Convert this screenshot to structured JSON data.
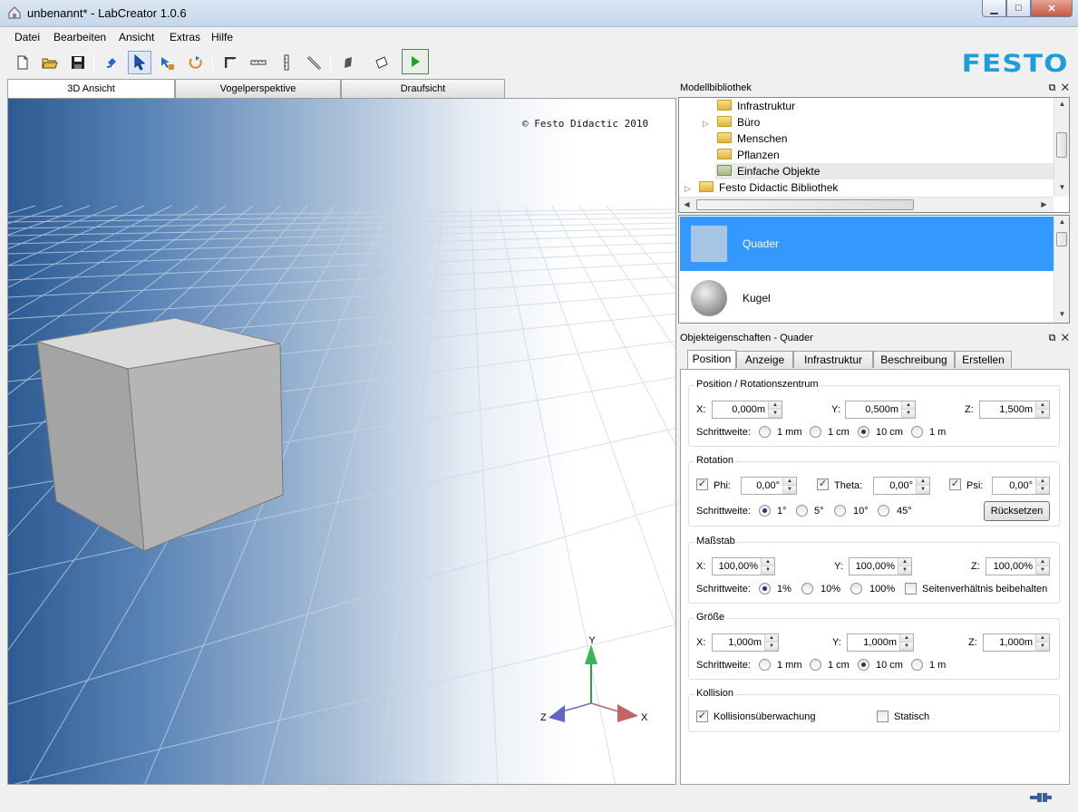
{
  "window": {
    "title": "unbenannt* - LabCreator 1.0.6",
    "min": "▁",
    "max": "□",
    "close": "✕"
  },
  "menu": [
    "Datei",
    "Bearbeiten",
    "Ansicht",
    "Extras",
    "Hilfe"
  ],
  "brand": {
    "logo_text": "FESTO",
    "color": "#1e9ed9"
  },
  "view_tabs": [
    "3D Ansicht",
    "Vogelperspektive",
    "Draufsicht"
  ],
  "viewport": {
    "copyright": "© Festo Didactic 2010",
    "axes": {
      "y": "Y",
      "x": "X",
      "z": "Z"
    }
  },
  "library": {
    "title": "Modellbibliothek",
    "items": [
      {
        "label": "Infrastruktur",
        "expander": ""
      },
      {
        "label": "Büro",
        "expander": "▷"
      },
      {
        "label": "Menschen",
        "expander": ""
      },
      {
        "label": "Pflanzen",
        "expander": ""
      },
      {
        "label": "Einfache Objekte",
        "expander": ""
      },
      {
        "label": "Festo Didactic Bibliothek",
        "expander": "▷"
      }
    ],
    "objects": [
      {
        "label": "Quader"
      },
      {
        "label": "Kugel"
      }
    ]
  },
  "properties": {
    "title": "Objekteigenschaften - Quader",
    "tabs": [
      "Position",
      "Anzeige",
      "Infrastruktur",
      "Beschreibung",
      "Erstellen"
    ],
    "position": {
      "title": "Position / Rotationszentrum",
      "x_label": "X:",
      "x": "0,000m",
      "y_label": "Y:",
      "y": "0,500m",
      "z_label": "Z:",
      "z": "1,500m",
      "step_label": "Schrittweite:",
      "steps": [
        "1 mm",
        "1 cm",
        "10 cm",
        "1 m"
      ],
      "selected_step": "10 cm"
    },
    "rotation": {
      "title": "Rotation",
      "phi_label": "Phi:",
      "phi": "0,00°",
      "theta_label": "Theta:",
      "theta": "0,00°",
      "psi_label": "Psi:",
      "psi": "0,00°",
      "step_label": "Schrittweite:",
      "steps": [
        "1°",
        "5°",
        "10°",
        "45°"
      ],
      "selected_step": "1°",
      "reset_button": "Rücksetzen"
    },
    "scale": {
      "title": "Maßstab",
      "x_label": "X:",
      "x": "100,00%",
      "y_label": "Y:",
      "y": "100,00%",
      "z_label": "Z:",
      "z": "100,00%",
      "step_label": "Schrittweite:",
      "steps": [
        "1%",
        "10%",
        "100%"
      ],
      "selected_step": "1%",
      "keep_ratio": "Seitenverhältnis beibehalten"
    },
    "size": {
      "title": "Größe",
      "x_label": "X:",
      "x": "1,000m",
      "y_label": "Y:",
      "y": "1,000m",
      "z_label": "Z:",
      "z": "1,000m",
      "step_label": "Schrittweite:",
      "steps": [
        "1 mm",
        "1 cm",
        "10 cm",
        "1 m"
      ],
      "selected_step": "10 cm"
    },
    "collision": {
      "title": "Kollision",
      "monitoring": "Kollisionsüberwachung",
      "static": "Statisch"
    }
  },
  "dock_controls": {
    "float": "⧉",
    "close": "✕"
  }
}
